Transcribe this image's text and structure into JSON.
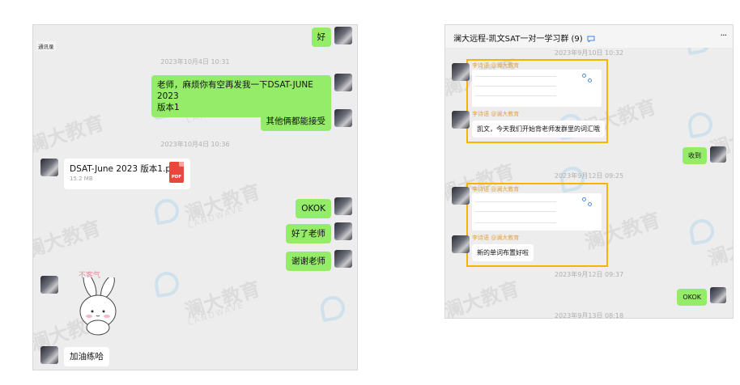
{
  "left": {
    "tag": "通讯录",
    "messages": {
      "hao": "好",
      "ts1": "2023年10月4日 10:31",
      "req_line1": "老师，麻烦你有空再发我一下DSAT-JUNE 2023",
      "req_line2": "版本1",
      "others_ok": "其他俩都能接受",
      "ts2": "2023年10月4日 10:36",
      "okok": "OKOK",
      "done": "好了老师",
      "thanks": "谢谢老师",
      "sticker_text": "不客气",
      "cheer": "加油练哈"
    },
    "file": {
      "name": "DSAT-June 2023 版本1.pdf",
      "size": "15.2 MB",
      "icon_label": "PDF"
    }
  },
  "right": {
    "title": "澜大远程-凯文SAT一对一学习群 (9)",
    "more": "···",
    "ts_top": "2023年9月10日 10:32",
    "sender1": "李诗语 @澜大教育",
    "sender2": "李诗语 @澜大教育",
    "msg1": "凯文，今天我们开始背老师发群里的词汇哦",
    "received": "收到",
    "ts_mid": "2023年9月12日 09:25",
    "sender3": "李诗语 @澜大教育",
    "sender4": "李诗语 @澜大教育",
    "msg2": "新的单词布置好啦",
    "ts_low": "2023年9月12日 09:37",
    "okok": "OKOK",
    "ts_bottom": "2023年9月13日 08:18"
  },
  "watermark": {
    "cn": "澜大教育",
    "en": "LANDWAVE"
  },
  "colors": {
    "green_bubble": "#95ec69",
    "highlight": "#f4b400",
    "sender_name": "#e2a449",
    "pdf_red": "#e7483b"
  }
}
